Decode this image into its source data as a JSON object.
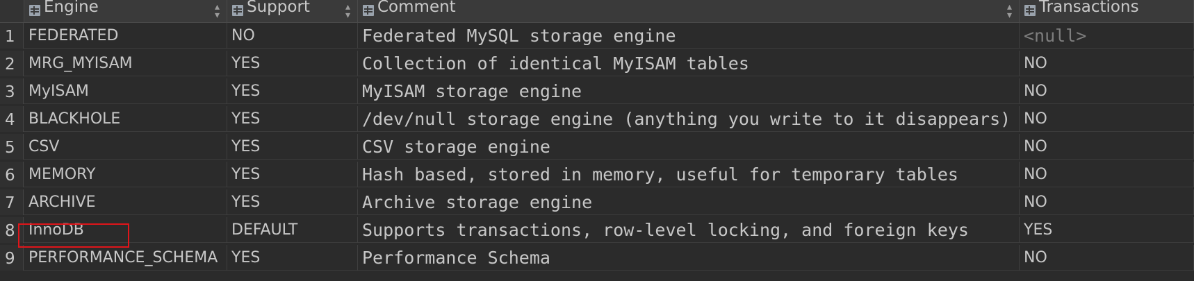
{
  "columns": [
    {
      "label": "Engine"
    },
    {
      "label": "Support"
    },
    {
      "label": "Comment"
    },
    {
      "label": "Transactions"
    }
  ],
  "rows": [
    {
      "num": "1",
      "engine": "FEDERATED",
      "support": "NO",
      "comment": "Federated MySQL storage engine",
      "transactions": "<null>"
    },
    {
      "num": "2",
      "engine": "MRG_MYISAM",
      "support": "YES",
      "comment": "Collection of identical MyISAM tables",
      "transactions": "NO"
    },
    {
      "num": "3",
      "engine": "MyISAM",
      "support": "YES",
      "comment": "MyISAM storage engine",
      "transactions": "NO"
    },
    {
      "num": "4",
      "engine": "BLACKHOLE",
      "support": "YES",
      "comment": "/dev/null storage engine (anything you write to it disappears)",
      "transactions": "NO"
    },
    {
      "num": "5",
      "engine": "CSV",
      "support": "YES",
      "comment": "CSV storage engine",
      "transactions": "NO"
    },
    {
      "num": "6",
      "engine": "MEMORY",
      "support": "YES",
      "comment": "Hash based, stored in memory, useful for temporary tables",
      "transactions": "NO"
    },
    {
      "num": "7",
      "engine": "ARCHIVE",
      "support": "YES",
      "comment": "Archive storage engine",
      "transactions": "NO"
    },
    {
      "num": "8",
      "engine": "InnoDB",
      "support": "DEFAULT",
      "comment": "Supports transactions, row-level locking, and foreign keys",
      "transactions": "YES"
    },
    {
      "num": "9",
      "engine": "PERFORMANCE_SCHEMA",
      "support": "YES",
      "comment": "Performance Schema",
      "transactions": "NO"
    }
  ],
  "colors": {
    "background": "#2b2b2b",
    "header_background": "#3a3a3a",
    "text": "#c7c7c7",
    "null_text": "#7e7e7e",
    "highlight_border": "#e0151a"
  },
  "highlighted_row": "8"
}
